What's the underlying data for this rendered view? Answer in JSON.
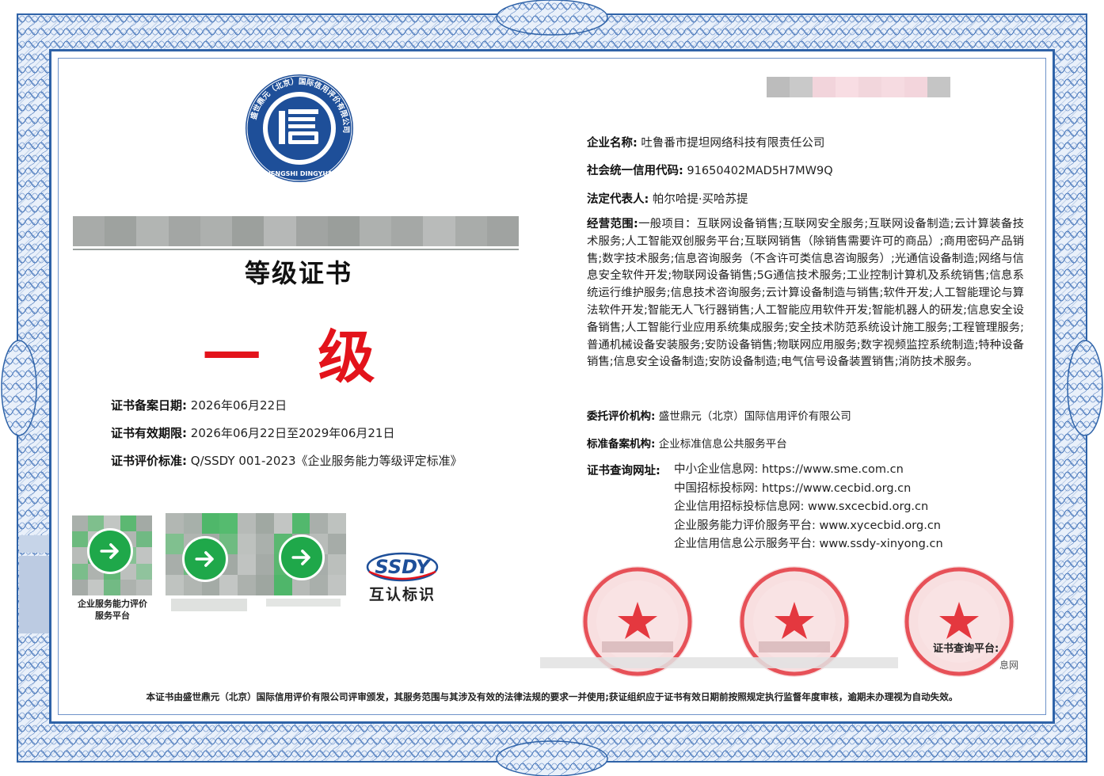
{
  "certificate": {
    "title": "等级证书",
    "grade": "一 级",
    "issuer_logo": {
      "ring_text": "盛世鼎元（北京）国际信用评价有限公司",
      "bottom_text": "SHENGSHI DINGYUAN",
      "center_glyph": "信"
    },
    "left_fields": [
      {
        "label": "证书备案日期:",
        "value": "2026年06月22日"
      },
      {
        "label": "证书有效期限:",
        "value": "2026年06月22日至2029年06月21日"
      },
      {
        "label": "证书评价标准:",
        "value": "Q/SSDY 001-2023《企业服务能力等级评定标准》"
      }
    ],
    "company": {
      "name_label": "企业名称:",
      "name": "吐鲁番市提坦网络科技有限责任公司",
      "credit_code_label": "社会统一信用代码:",
      "credit_code": "91650402MAD5H7MW9Q",
      "legal_rep_label": "法定代表人:",
      "legal_rep": "帕尔哈提·买哈苏提"
    },
    "scope": {
      "label": "经营范围:",
      "text": "一般项目：互联网设备销售;互联网安全服务;互联网设备制造;云计算装备技术服务;人工智能双创服务平台;互联网销售（除销售需要许可的商品）;商用密码产品销售;数字技术服务;信息咨询服务（不含许可类信息咨询服务）;光通信设备制造;网络与信息安全软件开发;物联网设备销售;5G通信技术服务;工业控制计算机及系统销售;信息系统运行维护服务;信息技术咨询服务;云计算设备制造与销售;软件开发;人工智能理论与算法软件开发;智能无人飞行器销售;人工智能应用软件开发;智能机器人的研发;信息安全设备销售;人工智能行业应用系统集成服务;安全技术防范系统设计施工服务;工程管理服务;普通机械设备安装服务;安防设备销售;物联网应用服务;数字视频监控系统制造;特种设备销售;信息安全设备制造;安防设备制造;电气信号设备装置销售;消防技术服务。"
    },
    "agency": {
      "label": "委托评价机构:",
      "value": "盛世鼎元（北京）国际信用评价有限公司"
    },
    "filing": {
      "label": "标准备案机构:",
      "value": "企业标准信息公共服务平台"
    },
    "query": {
      "label": "证书查询网址:",
      "sites": [
        "中小企业信息网: https://www.sme.com.cn",
        "中国招标投标网: https://www.cecbid.org.cn",
        "企业信用招标投标信息网: www.sxcecbid.org.cn",
        "企业服务能力评价服务平台: www.xycecbid.org.cn",
        "企业信用信息公示服务平台: www.ssdy-xinyong.cn"
      ]
    },
    "qr_caption_1": "企业服务能力评价服务平台",
    "ssdy_logo": "SSDY",
    "mutual_recognition": "互认标识",
    "seal_query_label": "证书查询平台:",
    "seal_info_suffix": "息网",
    "footer": "本证书由盛世鼎元（北京）国际信用评价有限公司评审颁发，其服务范围与其涉及有效的法律法规的要求一并使用;获证组织应于证书有效日期前按照规定执行监督年度审核，逾期未办理视为自动失效。",
    "colors": {
      "border_blue": "#2f63a8",
      "grade_red": "#e3131b",
      "qr_green": "#1fa84a",
      "seal_red": "#e4383f"
    }
  }
}
